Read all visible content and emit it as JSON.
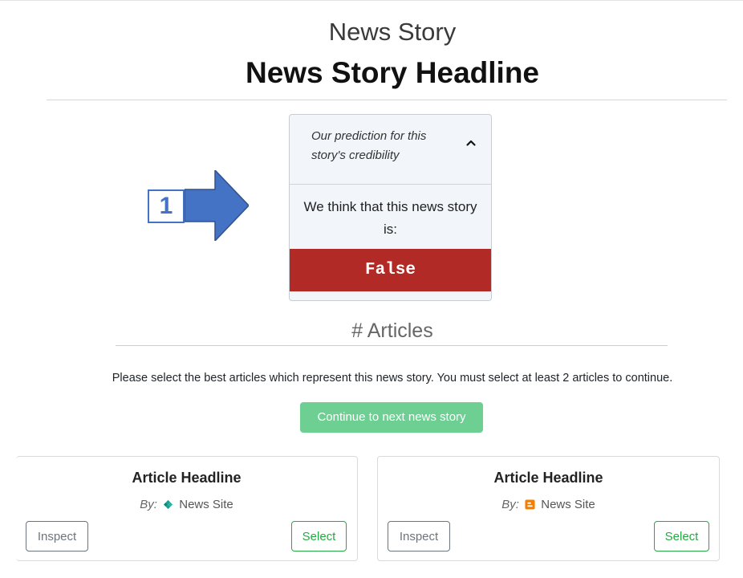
{
  "header": {
    "label": "News Story",
    "headline": "News Story Headline"
  },
  "annotation": {
    "step_number": "1",
    "arrow_color": "#4472c4"
  },
  "prediction": {
    "header_text": "Our prediction for this story's credibility",
    "body_text": "We think that this news story is:",
    "verdict": "False",
    "verdict_color": "#b22a25",
    "expanded": true
  },
  "articles_section": {
    "title": "# Articles",
    "instructions": "Please select the best articles which represent this news story. You must select at least 2 articles to continue.",
    "continue_label": "Continue to next news story"
  },
  "articles": [
    {
      "headline": "Article Headline",
      "by_label": "By:",
      "source": "News Site",
      "source_icon": "news-site-icon-green",
      "inspect_label": "Inspect",
      "select_label": "Select"
    },
    {
      "headline": "Article Headline",
      "by_label": "By:",
      "source": "News Site",
      "source_icon": "news-site-icon-orange",
      "inspect_label": "Inspect",
      "select_label": "Select"
    }
  ]
}
